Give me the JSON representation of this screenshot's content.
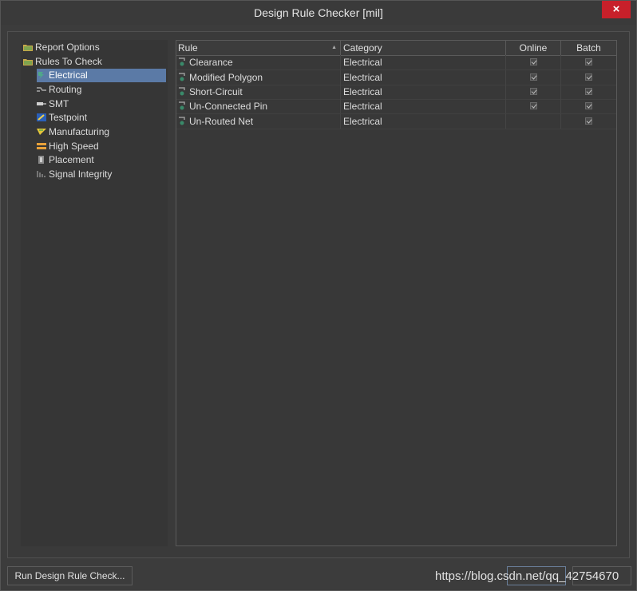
{
  "window": {
    "title": "Design Rule Checker [mil]",
    "close_label": "×"
  },
  "tree": {
    "items": [
      {
        "label": "Report Options",
        "icon": "folder-icon",
        "level": 0
      },
      {
        "label": "Rules To Check",
        "icon": "folder-icon",
        "level": 0
      },
      {
        "label": "Electrical",
        "icon": "electrical-icon",
        "level": 1,
        "selected": true
      },
      {
        "label": "Routing",
        "icon": "routing-icon",
        "level": 1
      },
      {
        "label": "SMT",
        "icon": "smt-icon",
        "level": 1
      },
      {
        "label": "Testpoint",
        "icon": "testpoint-icon",
        "level": 1
      },
      {
        "label": "Manufacturing",
        "icon": "manufacturing-icon",
        "level": 1
      },
      {
        "label": "High Speed",
        "icon": "high-speed-icon",
        "level": 1
      },
      {
        "label": "Placement",
        "icon": "placement-icon",
        "level": 1
      },
      {
        "label": "Signal Integrity",
        "icon": "signal-integrity-icon",
        "level": 1
      }
    ]
  },
  "grid": {
    "columns": {
      "rule": "Rule",
      "category": "Category",
      "online": "Online",
      "batch": "Batch"
    },
    "rows": [
      {
        "rule": "Clearance",
        "category": "Electrical",
        "online": true,
        "batch": true
      },
      {
        "rule": "Modified Polygon",
        "category": "Electrical",
        "online": true,
        "batch": true
      },
      {
        "rule": "Short-Circuit",
        "category": "Electrical",
        "online": true,
        "batch": true
      },
      {
        "rule": "Un-Connected Pin",
        "category": "Electrical",
        "online": true,
        "batch": true
      },
      {
        "rule": "Un-Routed Net",
        "category": "Electrical",
        "online": false,
        "batch": true
      }
    ]
  },
  "footer": {
    "run_button": "Run Design Rule Check...",
    "watermark": "https://blog.csdn.net/qq_42754670"
  },
  "colors": {
    "selection": "#5b7aa6",
    "close": "#c8202a",
    "background": "#3a3a3a"
  }
}
